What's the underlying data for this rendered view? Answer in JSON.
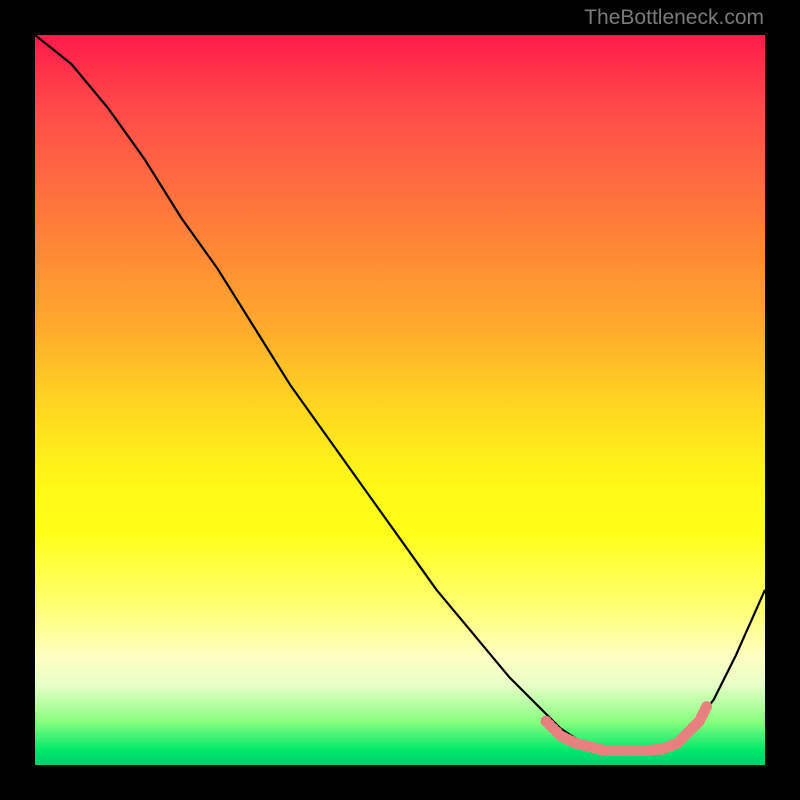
{
  "watermark": "TheBottleneck.com",
  "chart_data": {
    "type": "line",
    "title": "",
    "xlabel": "",
    "ylabel": "",
    "xlim": [
      0,
      100
    ],
    "ylim": [
      0,
      100
    ],
    "grid": false,
    "series": [
      {
        "name": "black-curve",
        "color": "#000000",
        "x": [
          0,
          5,
          10,
          15,
          20,
          25,
          30,
          35,
          40,
          45,
          50,
          55,
          60,
          65,
          70,
          72,
          75,
          78,
          80,
          83,
          86,
          88,
          90,
          93,
          96,
          100
        ],
        "y": [
          100,
          96,
          90,
          83,
          75,
          68,
          60,
          52,
          45,
          38,
          31,
          24,
          18,
          12,
          7,
          5,
          3,
          2,
          2,
          2,
          2,
          3,
          5,
          9,
          15,
          24
        ]
      },
      {
        "name": "pink-stipple",
        "color": "#e98080",
        "x": [
          70,
          72,
          74,
          76,
          78,
          80,
          82,
          84,
          86,
          88,
          90,
          91,
          92
        ],
        "y": [
          6,
          4,
          3,
          2.5,
          2,
          2,
          2,
          2,
          2.2,
          3,
          5,
          6,
          8
        ]
      }
    ],
    "background_gradient_stops": [
      {
        "pos": 0.0,
        "color": "#ff1a4a"
      },
      {
        "pos": 0.1,
        "color": "#ff4a4a"
      },
      {
        "pos": 0.2,
        "color": "#ff6a40"
      },
      {
        "pos": 0.3,
        "color": "#ff8a36"
      },
      {
        "pos": 0.4,
        "color": "#ffaa2c"
      },
      {
        "pos": 0.5,
        "color": "#ffd322"
      },
      {
        "pos": 0.6,
        "color": "#fff518"
      },
      {
        "pos": 0.68,
        "color": "#ffff17"
      },
      {
        "pos": 0.79,
        "color": "#ffff7a"
      },
      {
        "pos": 0.85,
        "color": "#ffffc0"
      },
      {
        "pos": 0.89,
        "color": "#e8ffc8"
      },
      {
        "pos": 0.94,
        "color": "#8aff80"
      },
      {
        "pos": 0.98,
        "color": "#00e86a"
      },
      {
        "pos": 1.0,
        "color": "#00d070"
      }
    ]
  }
}
